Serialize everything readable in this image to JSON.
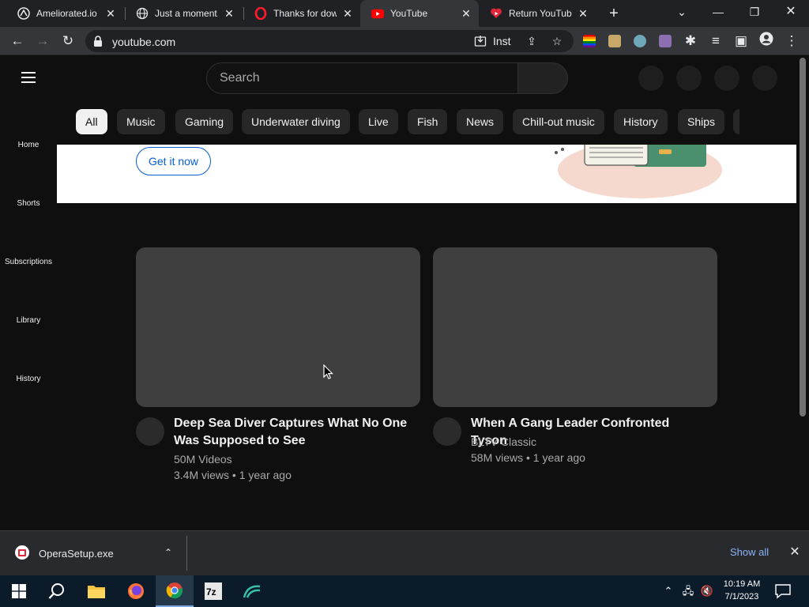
{
  "browser": {
    "tabs": [
      {
        "title": "Ameliorated.io",
        "active": false,
        "icon": "ameliorated-icon"
      },
      {
        "title": "Just a moment...",
        "active": false,
        "icon": "globe-icon"
      },
      {
        "title": "Thanks for downloading",
        "active": false,
        "icon": "opera-icon"
      },
      {
        "title": "YouTube",
        "active": true,
        "icon": "youtube-icon"
      },
      {
        "title": "Return YouTube",
        "active": false,
        "icon": "return-youtube-icon"
      }
    ],
    "url": "youtube.com",
    "install_label": "Inst"
  },
  "youtube": {
    "search_placeholder": "Search",
    "chips": [
      "All",
      "Music",
      "Gaming",
      "Underwater diving",
      "Live",
      "Fish",
      "News",
      "Chill-out music",
      "History",
      "Ships"
    ],
    "nav": [
      "Home",
      "Shorts",
      "Subscriptions",
      "Library",
      "History"
    ],
    "banner": {
      "cta": "Get it now"
    },
    "videos": [
      {
        "title": "Deep Sea Diver Captures What No One Was Supposed to See",
        "channel": "50M Videos",
        "meta": "3.4M views • 1 year ago"
      },
      {
        "title": "When A Gang Leader Confronted Tyson",
        "channel": "BLTV Classic",
        "meta": "58M views • 1 year ago"
      }
    ]
  },
  "downloads": {
    "file": "OperaSetup.exe",
    "show_all": "Show all"
  },
  "taskbar": {
    "time": "10:19 AM",
    "date": "7/1/2023"
  },
  "colors": {
    "youtube_bg": "#0f0f0f",
    "chip_selected": "#f1f1f1",
    "cta_blue": "#065fd4",
    "thumb_placeholder": "#3f3f3f"
  }
}
